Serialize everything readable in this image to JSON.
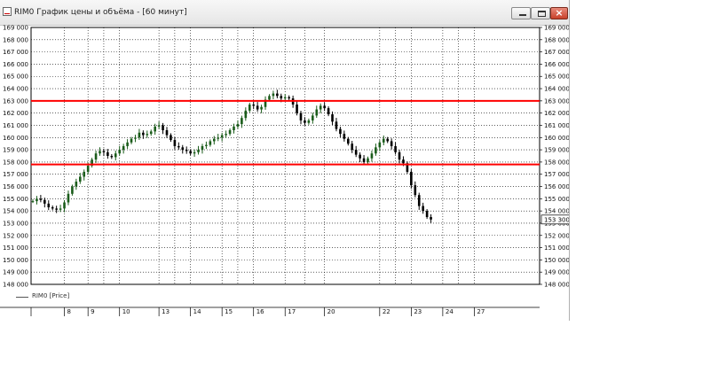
{
  "window": {
    "title": "RIM0 График цены и объёма - [60 минут]",
    "buttons": {
      "minimize": "minimize",
      "maximize": "maximize",
      "close": "×"
    }
  },
  "legend": {
    "label": "RIM0 [Price]"
  },
  "colors": {
    "level_line": "#ff0000",
    "up_candle": "#1a5c1a",
    "down_candle": "#000000",
    "grid": "#000000",
    "last_price_box": "#ffffff"
  },
  "chart_data": {
    "type": "candlestick",
    "instrument": "RIM0",
    "timeframe": "60 минут",
    "y_axis": {
      "ticks": [
        "148 000",
        "149 000",
        "150 000",
        "151 000",
        "152 000",
        "153 000",
        "154 000",
        "155 000",
        "156 000",
        "157 000",
        "158 000",
        "159 000",
        "160 000",
        "161 000",
        "162 000",
        "163 000",
        "164 000",
        "165 000",
        "166 000",
        "167 000",
        "168 000",
        "169 000"
      ],
      "range": [
        148000,
        169000
      ],
      "side": "both"
    },
    "x_axis": {
      "ticks": [
        "8",
        "9",
        "10",
        "13",
        "14",
        "15",
        "16",
        "17",
        "20",
        "22",
        "23",
        "24",
        "27"
      ],
      "tick_index": [
        8,
        14,
        22,
        32,
        40,
        48,
        56,
        64,
        74,
        88,
        96,
        104,
        112
      ]
    },
    "grid": true,
    "horizontal_levels": [
      163000,
      157800
    ],
    "last_price": "153 300",
    "close_series": [
      154800,
      155000,
      154900,
      154600,
      154300,
      154200,
      154100,
      154200,
      154700,
      155400,
      156000,
      156400,
      156800,
      157200,
      157700,
      158200,
      158700,
      158900,
      158800,
      158500,
      158400,
      158700,
      159000,
      159300,
      159600,
      159900,
      160000,
      160400,
      160200,
      160300,
      160500,
      160900,
      161000,
      160600,
      160200,
      159800,
      159300,
      159200,
      159000,
      158900,
      158700,
      158800,
      159000,
      159300,
      159400,
      159700,
      159900,
      160000,
      160200,
      160300,
      160600,
      160900,
      161100,
      161600,
      162200,
      162700,
      162600,
      162300,
      162500,
      163100,
      163400,
      163600,
      163400,
      163200,
      163300,
      163200,
      162700,
      162000,
      161400,
      161200,
      161400,
      161800,
      162300,
      162600,
      162400,
      161900,
      161300,
      160700,
      160300,
      159900,
      159500,
      159000,
      158600,
      158300,
      158000,
      158300,
      158700,
      159200,
      159600,
      159900,
      159700,
      159300,
      158800,
      158200,
      157900,
      157200,
      156100,
      155300,
      154400,
      154000,
      153500,
      153300
    ]
  }
}
